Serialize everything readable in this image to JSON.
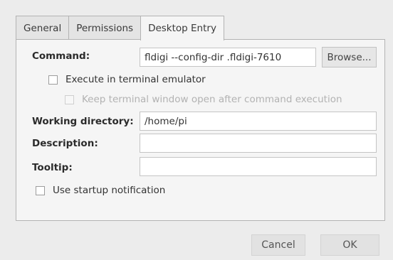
{
  "tabs": [
    {
      "label": "General"
    },
    {
      "label": "Permissions"
    },
    {
      "label": "Desktop Entry",
      "active": true
    }
  ],
  "command": {
    "label": "Command:",
    "value": "fldigi --config-dir .fldigi-7610",
    "browse_label": "Browse..."
  },
  "execute_in_terminal": {
    "label": "Execute in terminal emulator",
    "checked": false
  },
  "keep_terminal_open": {
    "label": "Keep terminal window open after command execution",
    "checked": false,
    "enabled": false
  },
  "working_directory": {
    "label": "Working directory:",
    "value": "/home/pi"
  },
  "description": {
    "label": "Description:",
    "value": ""
  },
  "tooltip": {
    "label": "Tooltip:",
    "value": ""
  },
  "startup_notification": {
    "label": "Use startup notification",
    "checked": false
  },
  "footer": {
    "cancel_label": "Cancel",
    "ok_label": "OK"
  }
}
